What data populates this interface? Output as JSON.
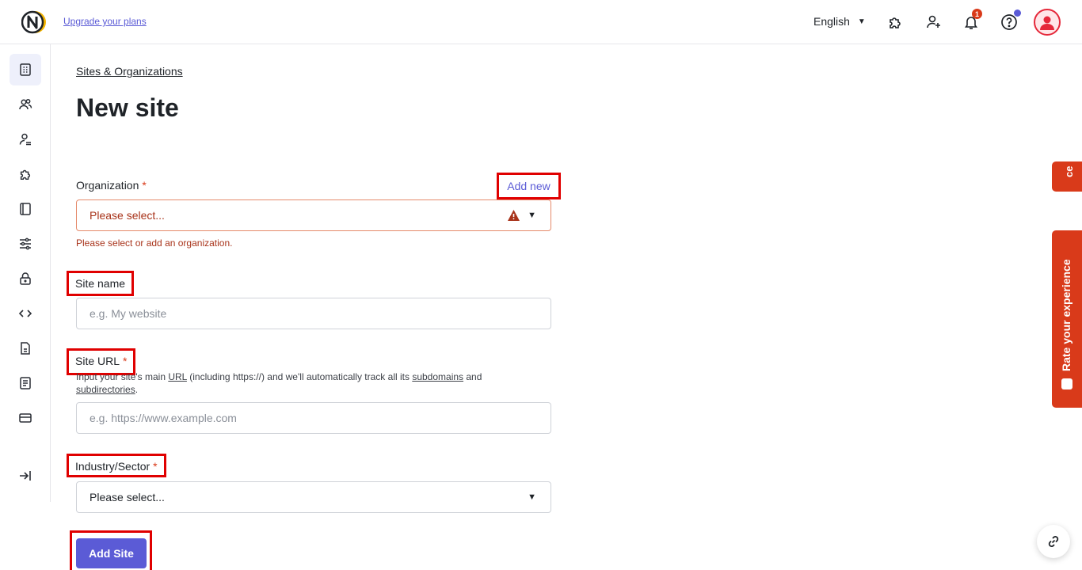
{
  "header": {
    "upgrade_link": "Upgrade your plans",
    "language": "English",
    "notification_count": "1",
    "icons": [
      "logo-icon",
      "integrations-icon",
      "invite-user-icon",
      "bell-icon",
      "help-icon",
      "avatar-icon"
    ]
  },
  "sidebar": {
    "items": [
      "sites-icon",
      "users-icon",
      "user-icon",
      "integrations-icon",
      "book-icon",
      "sliders-icon",
      "lock-icon",
      "code-icon",
      "document-icon",
      "list-icon",
      "card-icon",
      "collapse-icon"
    ]
  },
  "breadcrumb": "Sites & Organizations",
  "title": "New site",
  "form": {
    "organization": {
      "label": "Organization",
      "required": "*",
      "add_new": "Add new",
      "placeholder": "Please select...",
      "error": "Please select or add an organization."
    },
    "site_name": {
      "label": "Site name",
      "placeholder": "e.g. My website"
    },
    "site_url": {
      "label": "Site URL",
      "required": "*",
      "help_1": "Input your site's main ",
      "help_url": "URL",
      "help_2": " (including https://) and we'll automatically track all its ",
      "help_subdomains": "subdomains",
      "help_3": " and",
      "help_subdirectories": "subdirectories",
      "help_4": ".",
      "placeholder": "e.g. https://www.example.com"
    },
    "industry": {
      "label": "Industry/Sector",
      "required": "*",
      "placeholder": "Please select..."
    },
    "submit": "Add Site"
  },
  "right_tabs": {
    "top_tab": "ce",
    "rate": "Rate your experience"
  },
  "colors": {
    "accent": "#5b5bd6",
    "error": "#a8331a",
    "highlight": "#e00000",
    "feedback_tab": "#d93a1a"
  }
}
